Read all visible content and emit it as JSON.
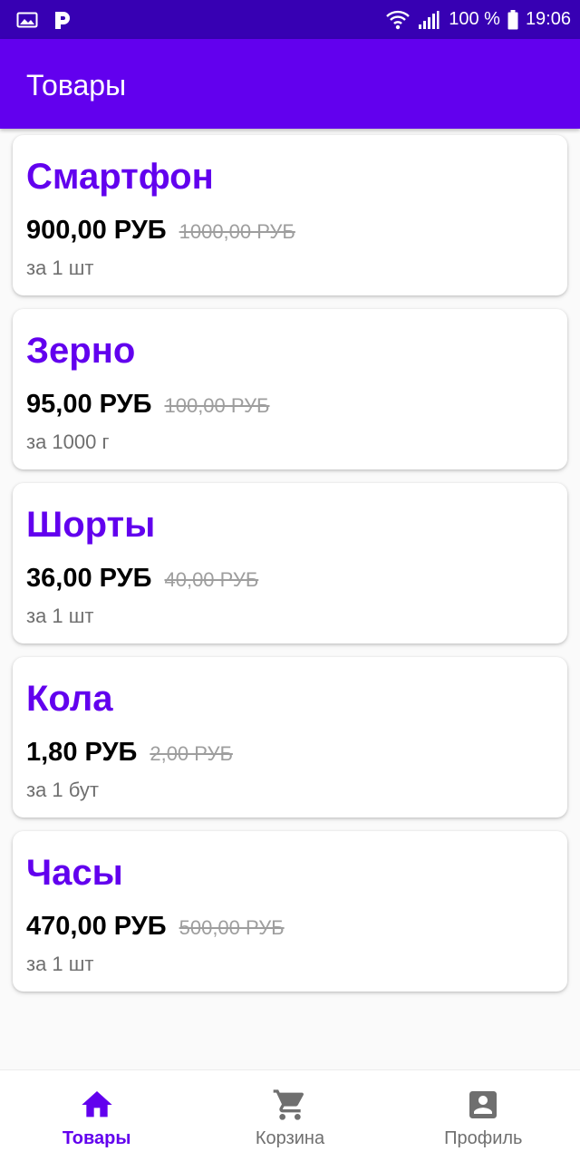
{
  "status_bar": {
    "battery": "100 %",
    "time": "19:06",
    "icons": [
      "gallery-icon",
      "p-app-icon",
      "wifi-icon",
      "signal-icon",
      "battery-icon"
    ]
  },
  "app_bar": {
    "title": "Товары"
  },
  "products": [
    {
      "name": "Смартфон",
      "price": "900,00 РУБ",
      "old_price": "1000,00 РУБ",
      "unit": "за 1 шт"
    },
    {
      "name": "Зерно",
      "price": "95,00 РУБ",
      "old_price": "100,00 РУБ",
      "unit": "за 1000 г"
    },
    {
      "name": "Шорты",
      "price": "36,00 РУБ",
      "old_price": "40,00 РУБ",
      "unit": "за 1 шт"
    },
    {
      "name": "Кола",
      "price": "1,80 РУБ",
      "old_price": "2,00 РУБ",
      "unit": "за 1 бут"
    },
    {
      "name": "Часы",
      "price": "470,00 РУБ",
      "old_price": "500,00 РУБ",
      "unit": "за 1 шт"
    }
  ],
  "bottom_nav": {
    "items": [
      {
        "label": "Товары",
        "icon": "home-icon",
        "active": true
      },
      {
        "label": "Корзина",
        "icon": "cart-icon",
        "active": false
      },
      {
        "label": "Профиль",
        "icon": "profile-icon",
        "active": false
      }
    ]
  },
  "colors": {
    "status_bar": "#3700b3",
    "primary": "#6200ee",
    "price": "#000000",
    "old_price": "#9e9e9e",
    "unit": "#6f6f6f",
    "nav_inactive": "#6f6f6f"
  }
}
